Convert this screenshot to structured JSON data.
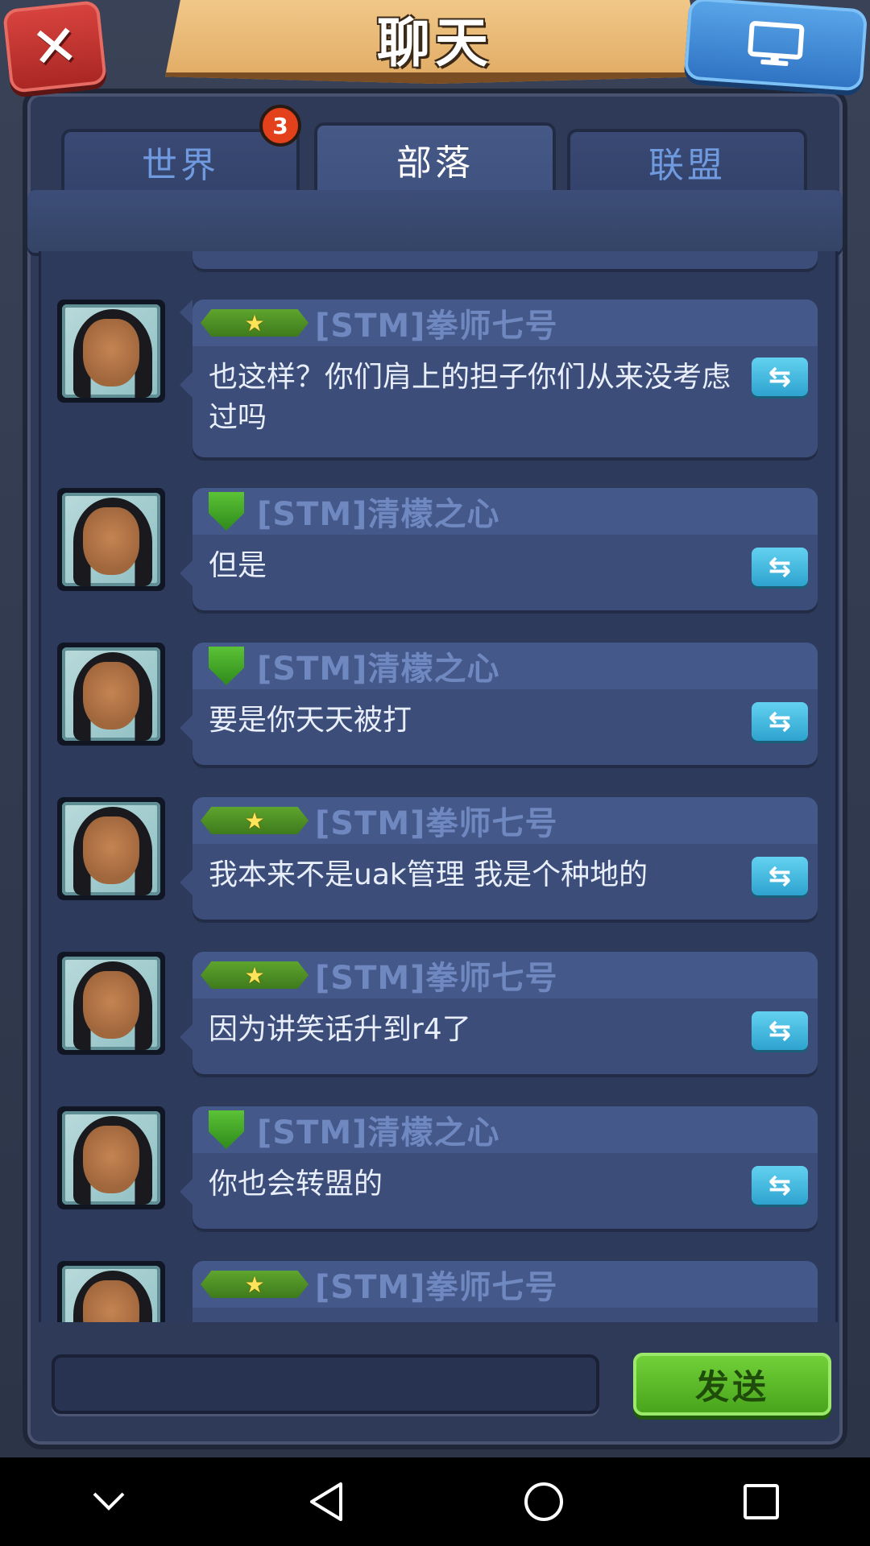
{
  "header": {
    "title": "聊天",
    "close_icon": "close-icon",
    "screen_icon": "monitor-icon"
  },
  "tabs": [
    {
      "label": "世界",
      "active": false
    },
    {
      "label": "部落",
      "active": true
    },
    {
      "label": "联盟",
      "active": false
    }
  ],
  "world_badge": "3",
  "messages": [
    {
      "sender": "[STM]拳师七号",
      "rank": "stars",
      "text": "也这样？你们肩上的担子你们从来没考虑过吗"
    },
    {
      "sender": "[STM]清檬之心",
      "rank": "shield",
      "text": "但是"
    },
    {
      "sender": "[STM]清檬之心",
      "rank": "shield",
      "text": "要是你天天被打"
    },
    {
      "sender": "[STM]拳师七号",
      "rank": "stars",
      "text": "我本来不是uak管理 我是个种地的"
    },
    {
      "sender": "[STM]拳师七号",
      "rank": "stars",
      "text": "因为讲笑话升到r4了"
    },
    {
      "sender": "[STM]清檬之心",
      "rank": "shield",
      "text": "你也会转盟的"
    },
    {
      "sender": "[STM]拳师七号",
      "rank": "stars",
      "text": ""
    }
  ],
  "input": {
    "value": "",
    "placeholder": ""
  },
  "send_label": "发送",
  "colors": {
    "accent_green": "#5bb82a",
    "tab_text": "#6f9adf",
    "badge": "#e3401c"
  },
  "nav": [
    "back-chevron-icon",
    "back-triangle-icon",
    "home-circle-icon",
    "recents-square-icon"
  ]
}
